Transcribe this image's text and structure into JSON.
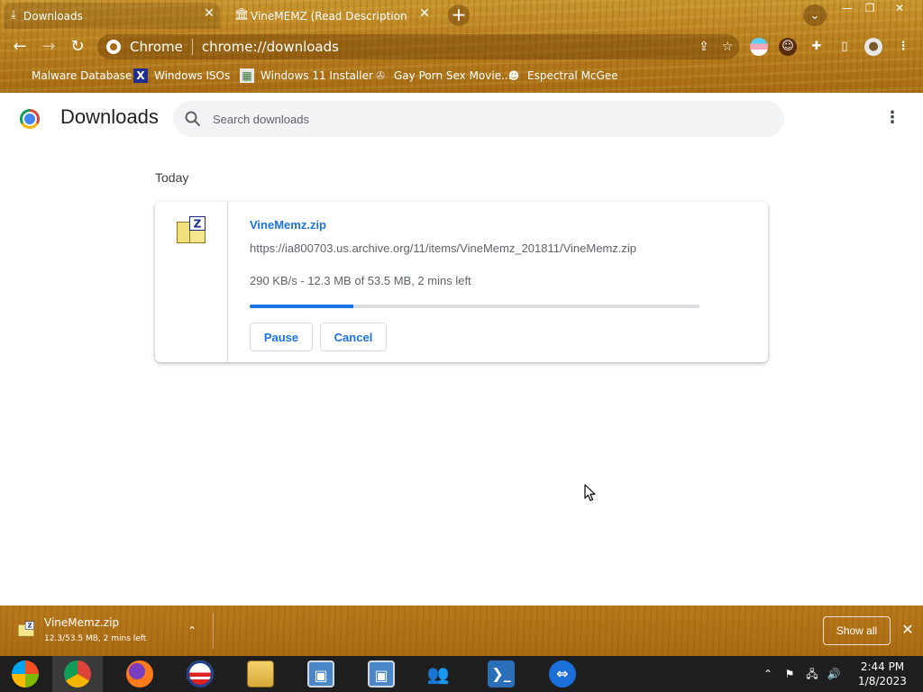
{
  "tabs": [
    {
      "title": "Downloads",
      "icon": "download-icon"
    },
    {
      "title": "VineMEMZ (Read Description) : F",
      "icon": "archive-icon"
    }
  ],
  "window_controls": {
    "minimize": "—",
    "restore": "❐",
    "close": "✕"
  },
  "toolbar": {
    "omnibox_label": "Chrome",
    "url": "chrome://downloads"
  },
  "bookmarks": [
    {
      "label": "Malware Database"
    },
    {
      "label": "Windows ISOs"
    },
    {
      "label": "Windows 11 Installer"
    },
    {
      "label": "Gay Porn Sex Movie..."
    },
    {
      "label": "Espectral McGee"
    }
  ],
  "page": {
    "title": "Downloads",
    "search_placeholder": "Search downloads",
    "section": "Today"
  },
  "download": {
    "file_name": "VineMemz.zip",
    "url": "https://ia800703.us.archive.org/11/items/VineMemz_201811/VineMemz.zip",
    "status": "290 KB/s - 12.3 MB of 53.5 MB, 2 mins left",
    "progress_fraction": 0.23,
    "pause_label": "Pause",
    "cancel_label": "Cancel"
  },
  "shelf": {
    "file_name": "VineMemz.zip",
    "status": "12.3/53.5 MB, 2 mins left",
    "show_all_label": "Show all"
  },
  "clock": {
    "time": "2:44 PM",
    "date": "1/8/2023"
  },
  "colors": {
    "accent": "#1a73e8",
    "frame": "#b9801e",
    "taskbar": "#1f1f1f"
  }
}
